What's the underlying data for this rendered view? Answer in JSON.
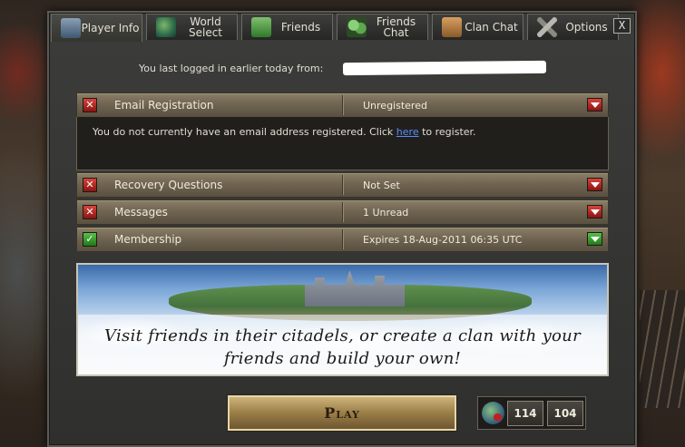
{
  "tabs": [
    {
      "label": "Player Info",
      "icon": "player-icon",
      "active": true
    },
    {
      "label": "World Select",
      "icon": "world-icon"
    },
    {
      "label": "Friends",
      "icon": "friends-icon"
    },
    {
      "label": "Friends Chat",
      "icon": "friends-chat-icon"
    },
    {
      "label": "Clan Chat",
      "icon": "clan-icon"
    },
    {
      "label": "Options",
      "icon": "options-icon"
    }
  ],
  "close_label": "X",
  "last_login": "You last logged in earlier today from:",
  "rows": {
    "email": {
      "label": "Email Registration",
      "value": "Unregistered",
      "status": "bad"
    },
    "recovery": {
      "label": "Recovery Questions",
      "value": "Not Set",
      "status": "bad"
    },
    "messages": {
      "label": "Messages",
      "value": "1 Unread",
      "status": "bad"
    },
    "membership": {
      "label": "Membership",
      "value": "Expires 18-Aug-2011 06:35 UTC",
      "status": "good"
    }
  },
  "email_details": {
    "text_before": "You do not currently have an email address registered. Click ",
    "link": "here",
    "text_after": " to register."
  },
  "banner_text": {
    "line1": "Visit friends in their citadels, or create a clan with your",
    "line2": "friends and build your own!"
  },
  "play_label": "Play",
  "stats": {
    "value1": "114",
    "value2": "104"
  },
  "colors": {
    "status_bad": "#c0302a",
    "status_good": "#3aa030",
    "link": "#5a8cff"
  }
}
